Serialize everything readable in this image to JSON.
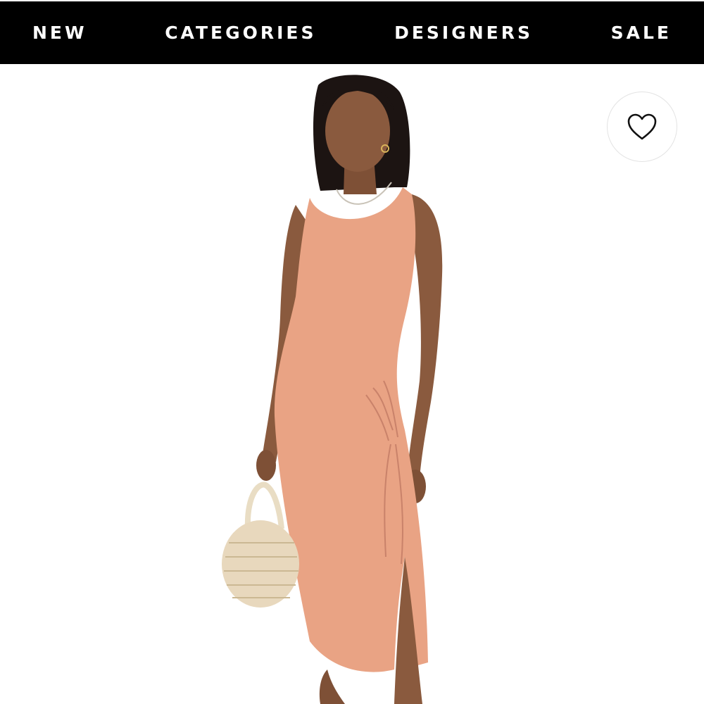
{
  "nav": {
    "items": [
      {
        "label": "NEW"
      },
      {
        "label": "CATEGORIES"
      },
      {
        "label": "DESIGNERS"
      },
      {
        "label": "SALE"
      }
    ]
  },
  "product": {
    "image": {
      "description_icon": "model-in-dress-photo",
      "colors": {
        "dress": "#e9a384",
        "skin": "#8a5a3e",
        "hair": "#1c1412",
        "bag": "#e8d8bd",
        "background": "#ffffff"
      }
    },
    "wishlist": {
      "icon": "heart-outline-icon"
    }
  },
  "colors": {
    "nav_background": "#000000",
    "nav_text": "#ffffff"
  }
}
